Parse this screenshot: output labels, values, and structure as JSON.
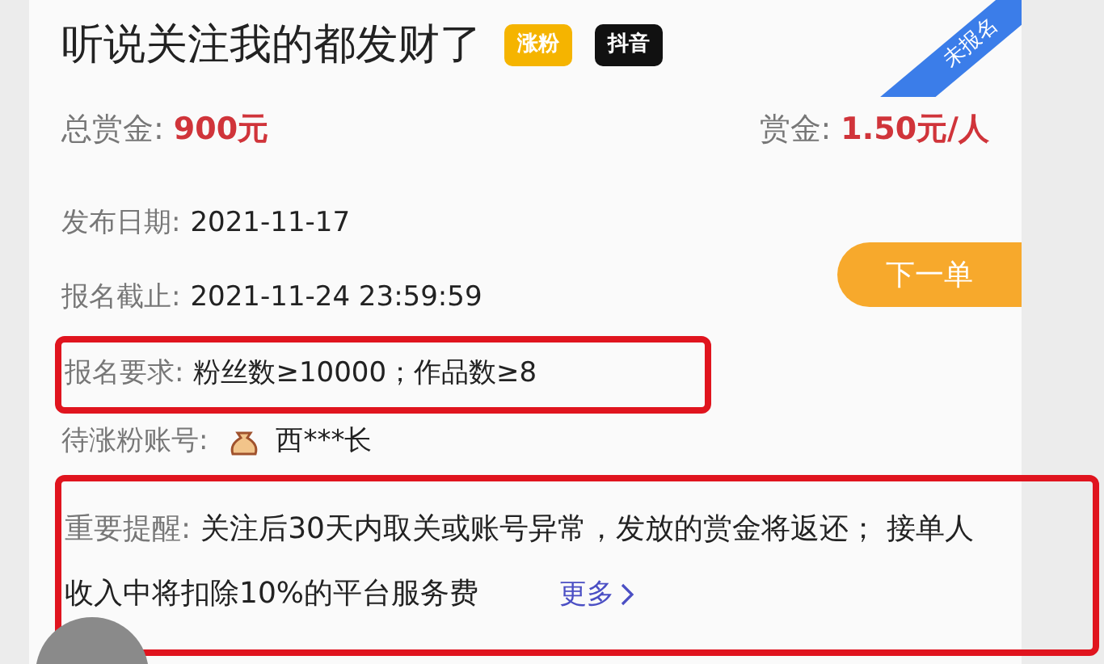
{
  "title": "听说关注我的都发财了",
  "tags": [
    {
      "label": "涨粉",
      "color": "#f5b400"
    },
    {
      "label": "抖音",
      "color": "#111111"
    }
  ],
  "ribbon": "未报名",
  "total_reward": {
    "label": "总赏金:",
    "value": "900元"
  },
  "unit_reward": {
    "label": "赏金:",
    "value": "1.50元/人"
  },
  "fields": [
    {
      "label": "发布日期:",
      "value": "2021-11-17",
      "highlighted": false
    },
    {
      "label": "报名截止:",
      "value": "2021-11-24 23:59:59",
      "highlighted": false
    },
    {
      "label": "报名要求:",
      "value": "粉丝数≥10000；作品数≥8",
      "highlighted": true
    }
  ],
  "account": {
    "label": "待涨粉账号:",
    "value": "西***长"
  },
  "next_button": "下一单",
  "notice": {
    "label": "重要提醒:",
    "text": "关注后30天内取关或账号异常，发放的赏金将返还； 接单人收入中将扣除10%的平台服务费",
    "more": "更多",
    "highlighted": true
  }
}
